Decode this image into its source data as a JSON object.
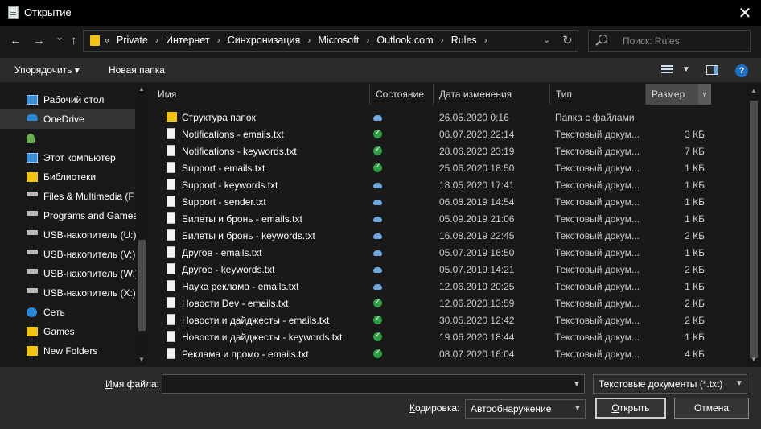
{
  "window": {
    "title": "Открытие",
    "close_glyph": "✕"
  },
  "nav": {
    "back_glyph": "←",
    "forward_glyph": "→",
    "recent_glyph": "⌄",
    "up_glyph": "↑",
    "overflow": "«",
    "breadcrumbs": [
      "Private",
      "Интернет",
      "Синхронизация",
      "Microsoft",
      "Outlook.com",
      "Rules"
    ],
    "crumb_sep": "›",
    "dropdown_glyph": "⌄",
    "refresh_glyph": "↻"
  },
  "search": {
    "placeholder": "Поиск: Rules"
  },
  "toolbar": {
    "organize_label": "Упорядочить ▾",
    "new_folder_label": "Новая папка",
    "help_label": "?"
  },
  "sidebar": {
    "items": [
      {
        "label": "Рабочий стол",
        "icon": "desktop-icon"
      },
      {
        "label": "OneDrive",
        "icon": "cloud-icon",
        "selected": true
      },
      {
        "label": "",
        "icon": "user-icon"
      },
      {
        "label": "Этот компьютер",
        "icon": "computer-icon"
      },
      {
        "label": "Библиотеки",
        "icon": "library-icon"
      },
      {
        "label": "Files & Multimedia (F",
        "icon": "drive-icon"
      },
      {
        "label": "Programs and Games",
        "icon": "drive-icon"
      },
      {
        "label": "USB-накопитель (U:)",
        "icon": "usb-drive-icon"
      },
      {
        "label": "USB-накопитель (V:)",
        "icon": "usb-drive-icon"
      },
      {
        "label": "USB-накопитель (W:)",
        "icon": "usb-drive-icon"
      },
      {
        "label": "USB-накопитель (X:)",
        "icon": "usb-drive-icon"
      },
      {
        "label": "Сеть",
        "icon": "network-icon"
      },
      {
        "label": "Games",
        "icon": "folder-icon"
      },
      {
        "label": "New Folders",
        "icon": "folder-icon"
      }
    ]
  },
  "columns": {
    "name": "Имя",
    "status": "Состояние",
    "date": "Дата изменения",
    "type": "Тип",
    "size": "Размер"
  },
  "files": [
    {
      "name": "Структура папок",
      "status": "cloud",
      "date": "26.05.2020 0:16",
      "type": "Папка с файлами",
      "size": "",
      "folder": true
    },
    {
      "name": "Notifications - emails.txt",
      "status": "synced",
      "date": "06.07.2020 22:14",
      "type": "Текстовый докум...",
      "size": "3 КБ"
    },
    {
      "name": "Notifications - keywords.txt",
      "status": "synced",
      "date": "28.06.2020 23:19",
      "type": "Текстовый докум...",
      "size": "7 КБ"
    },
    {
      "name": "Support - emails.txt",
      "status": "synced",
      "date": "25.06.2020 18:50",
      "type": "Текстовый докум...",
      "size": "1 КБ"
    },
    {
      "name": "Support - keywords.txt",
      "status": "cloud",
      "date": "18.05.2020 17:41",
      "type": "Текстовый докум...",
      "size": "1 КБ"
    },
    {
      "name": "Support - sender.txt",
      "status": "cloud",
      "date": "06.08.2019 14:54",
      "type": "Текстовый докум...",
      "size": "1 КБ"
    },
    {
      "name": "Билеты и бронь - emails.txt",
      "status": "cloud",
      "date": "05.09.2019 21:06",
      "type": "Текстовый докум...",
      "size": "1 КБ"
    },
    {
      "name": "Билеты и бронь - keywords.txt",
      "status": "cloud",
      "date": "16.08.2019 22:45",
      "type": "Текстовый докум...",
      "size": "2 КБ"
    },
    {
      "name": "Другое - emails.txt",
      "status": "cloud",
      "date": "05.07.2019 16:50",
      "type": "Текстовый докум...",
      "size": "1 КБ"
    },
    {
      "name": "Другое - keywords.txt",
      "status": "cloud",
      "date": "05.07.2019 14:21",
      "type": "Текстовый докум...",
      "size": "2 КБ"
    },
    {
      "name": "Наука реклама - emails.txt",
      "status": "cloud",
      "date": "12.06.2019 20:25",
      "type": "Текстовый докум...",
      "size": "1 КБ"
    },
    {
      "name": "Новости Dev - emails.txt",
      "status": "synced",
      "date": "12.06.2020 13:59",
      "type": "Текстовый докум...",
      "size": "2 КБ"
    },
    {
      "name": "Новости и дайджесты - emails.txt",
      "status": "synced",
      "date": "30.05.2020 12:42",
      "type": "Текстовый докум...",
      "size": "2 КБ"
    },
    {
      "name": "Новости и дайджесты - keywords.txt",
      "status": "synced",
      "date": "19.06.2020 18:44",
      "type": "Текстовый докум...",
      "size": "1 КБ"
    },
    {
      "name": "Реклама и промо - emails.txt",
      "status": "synced",
      "date": "08.07.2020 16:04",
      "type": "Текстовый докум...",
      "size": "4 КБ"
    }
  ],
  "bottom": {
    "filename_label_hotkey": "И",
    "filename_label_rest": "мя файла:",
    "filename_value": "",
    "filter_value": "Текстовые документы (*.txt)",
    "encoding_label_hotkey": "К",
    "encoding_label_rest": "одировка:",
    "encoding_value": "Автообнаружение",
    "open_hotkey": "О",
    "open_rest": "ткрыть",
    "cancel_label": "Отмена"
  },
  "colors": {
    "folder": "#f1c40f",
    "synced": "#2e9e44",
    "cloud": "#6fa8dc",
    "accent": "#1e6ec8"
  }
}
